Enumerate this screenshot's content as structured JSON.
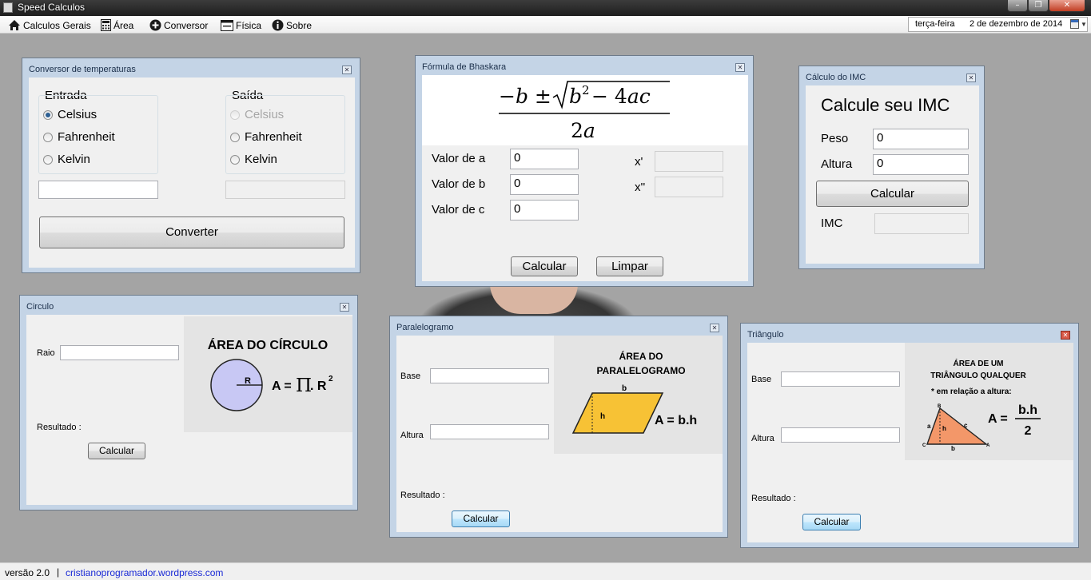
{
  "window": {
    "title": "Speed Calculos",
    "minimize_icon": "minimize-icon",
    "maximize_icon": "maximize-icon",
    "close_icon": "close-icon"
  },
  "menu": {
    "items": [
      {
        "label": "Calculos Gerais",
        "icon": "home-icon"
      },
      {
        "label": "Área",
        "icon": "calculator-icon"
      },
      {
        "label": "Conversor",
        "icon": "plus-circle-icon"
      },
      {
        "label": "Física",
        "icon": "window-icon"
      },
      {
        "label": "Sobre",
        "icon": "info-icon"
      }
    ],
    "date": {
      "weekday": "terça-feira",
      "sep": ".",
      "date": "2 de dezembro de 2014"
    }
  },
  "temp": {
    "title": "Conversor de temperaturas",
    "input_group": "Entrada",
    "output_group": "Saída",
    "options": [
      "Celsius",
      "Fahrenheit",
      "Kelvin"
    ],
    "input_selected": "Celsius",
    "output_disabled": "Celsius",
    "input_value": "",
    "output_value": "",
    "button": "Converter"
  },
  "bhaskara": {
    "title": "Fórmula de Bhaskara",
    "labels": [
      "Valor de a",
      "Valor de b",
      "Valor de c"
    ],
    "values": [
      "0",
      "0",
      "0"
    ],
    "x1_label": "x'",
    "x2_label": "x''",
    "x1_value": "",
    "x2_value": "",
    "calc_button": "Calcular",
    "clear_button": "Limpar"
  },
  "imc": {
    "title": "Cálculo do IMC",
    "heading": "Calcule seu IMC",
    "peso_label": "Peso",
    "peso_value": "0",
    "altura_label": "Altura",
    "altura_value": "0",
    "button": "Calcular",
    "result_label": "IMC",
    "result_value": ""
  },
  "circle": {
    "title": "Circulo",
    "raio_label": "Raio",
    "raio_value": "",
    "result_label": "Resultado :",
    "button": "Calcular",
    "figure": {
      "heading": "ÁREA DO CÍRCULO",
      "r_label": "R",
      "formula": "A =",
      "pi": "Π",
      "formula_tail": ". R",
      "exp": "2"
    }
  },
  "parallelogram": {
    "title": "Paralelogramo",
    "base_label": "Base",
    "base_value": "",
    "altura_label": "Altura",
    "altura_value": "",
    "result_label": "Resultado :",
    "button": "Calcular",
    "figure": {
      "heading1": "ÁREA DO",
      "heading2": "PARALELOGRAMO",
      "b_label": "b",
      "h_label": "h",
      "formula": "A = b.h"
    }
  },
  "triangle": {
    "title": "Triângulo",
    "base_label": "Base",
    "base_value": "",
    "altura_label": "Altura",
    "altura_value": "",
    "result_label": "Resultado :",
    "button": "Calcular",
    "figure": {
      "heading1": "ÁREA DE UM",
      "heading2": "TRIÂNGULO QUALQUER",
      "note": "* em relação a altura:",
      "formula": "A =",
      "num": "b.h",
      "den": "2",
      "labels": {
        "B": "B",
        "a": "a",
        "h": "h",
        "c": "c",
        "C": "C",
        "A": "A",
        "b": "b"
      }
    }
  },
  "status": {
    "version": "versão 2.0",
    "separator": "|",
    "link": "cristianoprogramador.wordpress.com"
  },
  "colors": {
    "accent": "#3c7fb1",
    "close_red": "#c13d22",
    "parallelogram_fill": "#f7c235",
    "triangle_fill": "#f39769",
    "circle_fill": "#c8c8f4"
  }
}
